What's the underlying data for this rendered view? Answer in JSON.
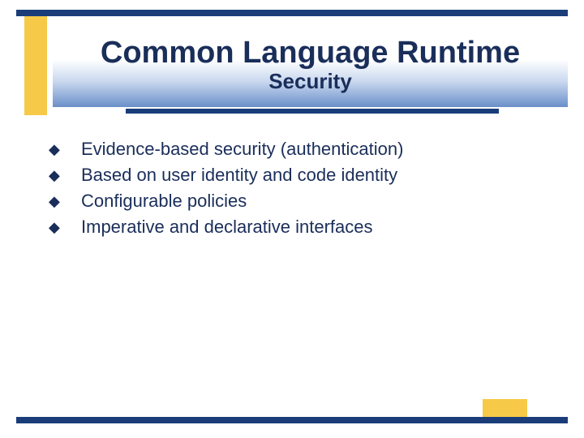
{
  "colors": {
    "blue_dark": "#1a3d7a",
    "text_navy": "#1a2e5a",
    "yellow": "#f7c948"
  },
  "header": {
    "title": "Common Language Runtime",
    "subtitle": "Security"
  },
  "bullets": [
    "Evidence-based security (authentication)",
    "Based on user identity and code identity",
    "Configurable policies",
    "Imperative and declarative interfaces"
  ]
}
